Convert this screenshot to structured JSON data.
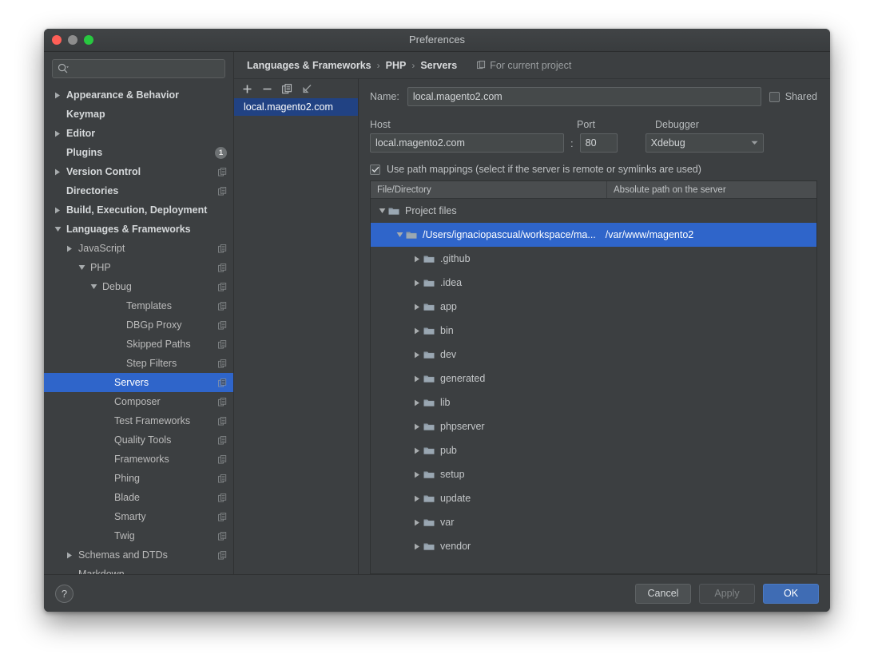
{
  "window": {
    "title": "Preferences",
    "traffic": {
      "close": "close-button",
      "minimize": "minimize-button",
      "zoom": "zoom-button"
    }
  },
  "sidebar": {
    "search": {
      "placeholder": "",
      "value": ""
    },
    "items": [
      {
        "label": "Appearance & Behavior",
        "indent": 0,
        "arrow": "right",
        "bold": true,
        "copy": false,
        "badge": ""
      },
      {
        "label": "Keymap",
        "indent": 0,
        "arrow": "none",
        "bold": true,
        "copy": false,
        "badge": ""
      },
      {
        "label": "Editor",
        "indent": 0,
        "arrow": "right",
        "bold": true,
        "copy": false,
        "badge": ""
      },
      {
        "label": "Plugins",
        "indent": 0,
        "arrow": "none",
        "bold": true,
        "copy": false,
        "badge": "1"
      },
      {
        "label": "Version Control",
        "indent": 0,
        "arrow": "right",
        "bold": true,
        "copy": true,
        "badge": ""
      },
      {
        "label": "Directories",
        "indent": 0,
        "arrow": "none",
        "bold": true,
        "copy": true,
        "badge": ""
      },
      {
        "label": "Build, Execution, Deployment",
        "indent": 0,
        "arrow": "right",
        "bold": true,
        "copy": false,
        "badge": ""
      },
      {
        "label": "Languages & Frameworks",
        "indent": 0,
        "arrow": "down",
        "bold": true,
        "copy": false,
        "badge": ""
      },
      {
        "label": "JavaScript",
        "indent": 1,
        "arrow": "right",
        "bold": false,
        "copy": true,
        "badge": ""
      },
      {
        "label": "PHP",
        "indent": 2,
        "arrow": "down",
        "bold": false,
        "copy": true,
        "badge": ""
      },
      {
        "label": "Debug",
        "indent": 3,
        "arrow": "down",
        "bold": false,
        "copy": true,
        "badge": ""
      },
      {
        "label": "Templates",
        "indent": 5,
        "arrow": "none",
        "bold": false,
        "copy": true,
        "badge": ""
      },
      {
        "label": "DBGp Proxy",
        "indent": 5,
        "arrow": "none",
        "bold": false,
        "copy": true,
        "badge": ""
      },
      {
        "label": "Skipped Paths",
        "indent": 5,
        "arrow": "none",
        "bold": false,
        "copy": true,
        "badge": ""
      },
      {
        "label": "Step Filters",
        "indent": 5,
        "arrow": "none",
        "bold": false,
        "copy": true,
        "badge": ""
      },
      {
        "label": "Servers",
        "indent": 4,
        "arrow": "none",
        "bold": false,
        "copy": true,
        "badge": "",
        "selected": true
      },
      {
        "label": "Composer",
        "indent": 4,
        "arrow": "none",
        "bold": false,
        "copy": true,
        "badge": ""
      },
      {
        "label": "Test Frameworks",
        "indent": 4,
        "arrow": "none",
        "bold": false,
        "copy": true,
        "badge": ""
      },
      {
        "label": "Quality Tools",
        "indent": 4,
        "arrow": "none",
        "bold": false,
        "copy": true,
        "badge": ""
      },
      {
        "label": "Frameworks",
        "indent": 4,
        "arrow": "none",
        "bold": false,
        "copy": true,
        "badge": ""
      },
      {
        "label": "Phing",
        "indent": 4,
        "arrow": "none",
        "bold": false,
        "copy": true,
        "badge": ""
      },
      {
        "label": "Blade",
        "indent": 4,
        "arrow": "none",
        "bold": false,
        "copy": true,
        "badge": ""
      },
      {
        "label": "Smarty",
        "indent": 4,
        "arrow": "none",
        "bold": false,
        "copy": true,
        "badge": ""
      },
      {
        "label": "Twig",
        "indent": 4,
        "arrow": "none",
        "bold": false,
        "copy": true,
        "badge": ""
      },
      {
        "label": "Schemas and DTDs",
        "indent": 1,
        "arrow": "right",
        "bold": false,
        "copy": true,
        "badge": ""
      },
      {
        "label": "Markdown",
        "indent": 1,
        "arrow": "none",
        "bold": false,
        "copy": false,
        "badge": ""
      }
    ]
  },
  "breadcrumb": {
    "items": [
      "Languages & Frameworks",
      "PHP",
      "Servers"
    ],
    "separator": "›",
    "note": "For current project"
  },
  "servers_panel": {
    "toolbar": [
      {
        "name": "add-server-button",
        "glyph": "+"
      },
      {
        "name": "remove-server-button",
        "glyph": "−"
      },
      {
        "name": "copy-server-button",
        "glyph": "copy"
      },
      {
        "name": "import-server-button",
        "glyph": "import"
      }
    ],
    "items": [
      {
        "label": "local.magento2.com",
        "selected": true
      }
    ]
  },
  "form": {
    "name_label": "Name:",
    "name_value": "local.magento2.com",
    "shared_label": "Shared",
    "shared_checked": false,
    "host_label": "Host",
    "host_value": "local.magento2.com",
    "colon": ":",
    "port_label": "Port",
    "port_value": "80",
    "debugger_label": "Debugger",
    "debugger_value": "Xdebug",
    "path_mappings_label": "Use path mappings (select if the server is remote or symlinks are used)",
    "path_mappings_checked": true
  },
  "mapping_table": {
    "columns": [
      "File/Directory",
      "Absolute path on the server"
    ],
    "rows": [
      {
        "name": "Project files",
        "server_path": "",
        "indent": 0,
        "arrow": "down",
        "selected": false
      },
      {
        "name": "/Users/ignaciopascual/workspace/ma...",
        "server_path": "/var/www/magento2",
        "indent": 1,
        "arrow": "down",
        "selected": true
      },
      {
        "name": ".github",
        "server_path": "",
        "indent": 2,
        "arrow": "right",
        "selected": false
      },
      {
        "name": ".idea",
        "server_path": "",
        "indent": 2,
        "arrow": "right",
        "selected": false
      },
      {
        "name": "app",
        "server_path": "",
        "indent": 2,
        "arrow": "right",
        "selected": false
      },
      {
        "name": "bin",
        "server_path": "",
        "indent": 2,
        "arrow": "right",
        "selected": false
      },
      {
        "name": "dev",
        "server_path": "",
        "indent": 2,
        "arrow": "right",
        "selected": false
      },
      {
        "name": "generated",
        "server_path": "",
        "indent": 2,
        "arrow": "right",
        "selected": false
      },
      {
        "name": "lib",
        "server_path": "",
        "indent": 2,
        "arrow": "right",
        "selected": false
      },
      {
        "name": "phpserver",
        "server_path": "",
        "indent": 2,
        "arrow": "right",
        "selected": false
      },
      {
        "name": "pub",
        "server_path": "",
        "indent": 2,
        "arrow": "right",
        "selected": false
      },
      {
        "name": "setup",
        "server_path": "",
        "indent": 2,
        "arrow": "right",
        "selected": false
      },
      {
        "name": "update",
        "server_path": "",
        "indent": 2,
        "arrow": "right",
        "selected": false
      },
      {
        "name": "var",
        "server_path": "",
        "indent": 2,
        "arrow": "right",
        "selected": false
      },
      {
        "name": "vendor",
        "server_path": "",
        "indent": 2,
        "arrow": "right",
        "selected": false
      }
    ]
  },
  "footer": {
    "help_label": "?",
    "cancel_label": "Cancel",
    "apply_label": "Apply",
    "ok_label": "OK",
    "apply_enabled": false
  },
  "colors": {
    "window_bg": "#3c3f41",
    "selection_blue": "#2f65ca",
    "list_selection_blue": "#214283",
    "primary_button": "#3f6cb4",
    "text": "#bbbbbb"
  }
}
